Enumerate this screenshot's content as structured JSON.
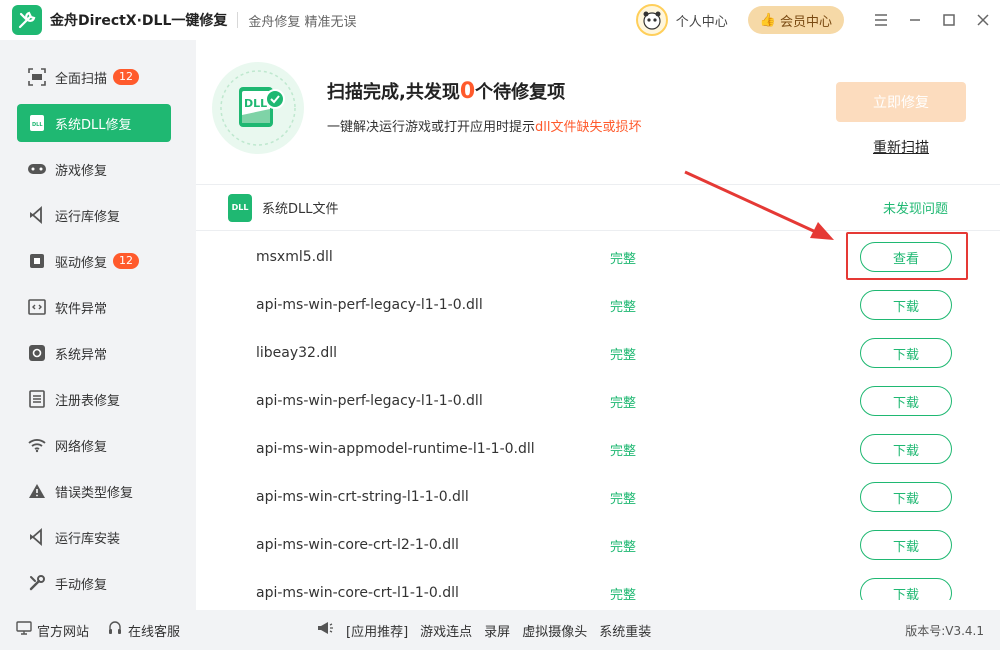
{
  "titlebar": {
    "app_name": "金舟DirectX·DLL一键修复",
    "slogan": "金舟修复 精准无误",
    "user_center": "个人中心",
    "vip": "会员中心"
  },
  "sidebar": {
    "items": [
      {
        "label": "全面扫描",
        "badge": "12",
        "icon": "scan-icon"
      },
      {
        "label": "系统DLL修复",
        "badge": "",
        "icon": "dll-icon"
      },
      {
        "label": "游戏修复",
        "badge": "",
        "icon": "gamepad-icon"
      },
      {
        "label": "运行库修复",
        "badge": "",
        "icon": "runtime-icon"
      },
      {
        "label": "驱动修复",
        "badge": "12",
        "icon": "driver-icon"
      },
      {
        "label": "软件异常",
        "badge": "",
        "icon": "code-icon"
      },
      {
        "label": "系统异常",
        "badge": "",
        "icon": "gear-icon"
      },
      {
        "label": "注册表修复",
        "badge": "",
        "icon": "list-icon"
      },
      {
        "label": "网络修复",
        "badge": "",
        "icon": "wifi-icon"
      },
      {
        "label": "错误类型修复",
        "badge": "",
        "icon": "warning-icon"
      },
      {
        "label": "运行库安装",
        "badge": "",
        "icon": "install-icon"
      },
      {
        "label": "手动修复",
        "badge": "",
        "icon": "wrench-icon"
      }
    ]
  },
  "header": {
    "title_prefix": "扫描完成,共发现",
    "count": "0",
    "title_suffix": "个待修复项",
    "sub_prefix": "一键解决运行游戏或打开应用时提示",
    "sub_highlight": "dll文件缺失或损坏",
    "fix_button": "立即修复",
    "rescan": "重新扫描",
    "icon_text": "DLL"
  },
  "section": {
    "title": "系统DLL文件",
    "status": "未发现问题",
    "icon_text": "DLL"
  },
  "files": [
    {
      "name": "msxml5.dll",
      "status": "完整",
      "action": "查看"
    },
    {
      "name": "api-ms-win-perf-legacy-l1-1-0.dll",
      "status": "完整",
      "action": "下载"
    },
    {
      "name": "libeay32.dll",
      "status": "完整",
      "action": "下载"
    },
    {
      "name": "api-ms-win-perf-legacy-l1-1-0.dll",
      "status": "完整",
      "action": "下载"
    },
    {
      "name": "api-ms-win-appmodel-runtime-l1-1-0.dll",
      "status": "完整",
      "action": "下载"
    },
    {
      "name": "api-ms-win-crt-string-l1-1-0.dll",
      "status": "完整",
      "action": "下载"
    },
    {
      "name": "api-ms-win-core-crt-l2-1-0.dll",
      "status": "完整",
      "action": "下载"
    },
    {
      "name": "api-ms-win-core-crt-l1-1-0.dll",
      "status": "完整",
      "action": "下载"
    }
  ],
  "footer": {
    "official_site": "官方网站",
    "online_service": "在线客服",
    "recommend": "[应用推荐]",
    "links": [
      "游戏连点",
      "录屏",
      "虚拟摄像头",
      "系统重装"
    ],
    "version": "版本号:V3.4.1"
  },
  "colors": {
    "accent": "#1fb872",
    "highlight": "#ff5a2c",
    "annotation": "#e53935"
  }
}
